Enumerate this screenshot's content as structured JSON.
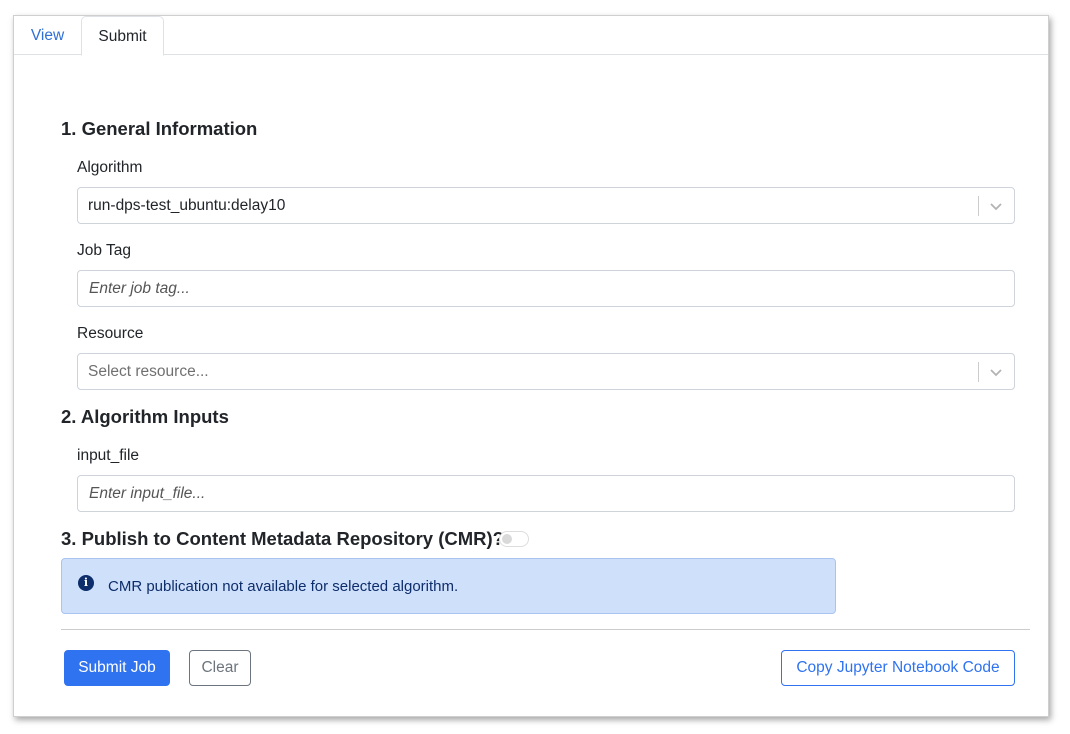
{
  "tabs": [
    {
      "label": "View"
    },
    {
      "label": "Submit"
    }
  ],
  "sections": {
    "general": "1. General Information",
    "inputs": "2. Algorithm Inputs",
    "publish": "3. Publish to Content Metadata Repository (CMR)?"
  },
  "algorithm": {
    "label": "Algorithm",
    "value": "run-dps-test_ubuntu:delay10"
  },
  "job_tag": {
    "label": "Job Tag",
    "placeholder": "Enter job tag..."
  },
  "resource": {
    "label": "Resource",
    "placeholder": "Select resource..."
  },
  "input_file": {
    "label": "input_file",
    "placeholder": "Enter input_file..."
  },
  "publish_toggle": {
    "checked": false
  },
  "alert": {
    "icon": "info-icon",
    "text": "CMR publication not available for selected algorithm."
  },
  "buttons": {
    "submit": "Submit Job",
    "clear": "Clear",
    "copy": "Copy Jupyter Notebook Code"
  },
  "colors": {
    "primary": "#2f73f0",
    "alert_bg": "#cfe0fb",
    "alert_text": "#0d2d6b"
  }
}
